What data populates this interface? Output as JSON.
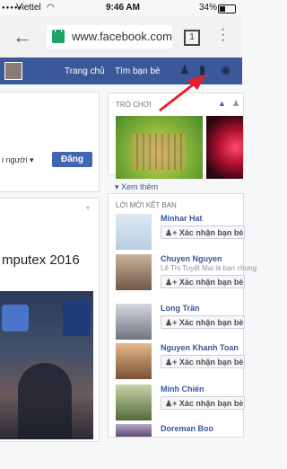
{
  "status_bar": {
    "carrier": "Viettel",
    "time": "9:46 AM",
    "battery": "34%"
  },
  "browser": {
    "url": "www.facebook.com",
    "tab_count": "1"
  },
  "fb_nav": {
    "items": [
      "Trang chủ",
      "Tìm bạn bè"
    ]
  },
  "composer": {
    "privacy_label": "i người",
    "post_button": "Đăng"
  },
  "post": {
    "title": "mputex 2016"
  },
  "games": {
    "header": "TRÒ CHƠI",
    "see_more": "Xem thêm"
  },
  "friend_invites": {
    "header": "LỜI MỜI KẾT BẠN",
    "confirm_label": "Xác nhận bạn bè",
    "people": [
      {
        "name": "Minhar Hat",
        "sub": ""
      },
      {
        "name": "Chuyen Nguyen",
        "sub": "Lê Thị Tuyết Mai là bạn chung"
      },
      {
        "name": "Long Trần",
        "sub": ""
      },
      {
        "name": "Nguyen Khanh Toan",
        "sub": ""
      },
      {
        "name": "Minh Chiến",
        "sub": ""
      },
      {
        "name": "Doreman Boo",
        "sub": ""
      }
    ]
  },
  "colors": {
    "facebook_blue": "#3b5998",
    "button_blue": "#4267b2",
    "arrow_red": "#e8202a"
  }
}
